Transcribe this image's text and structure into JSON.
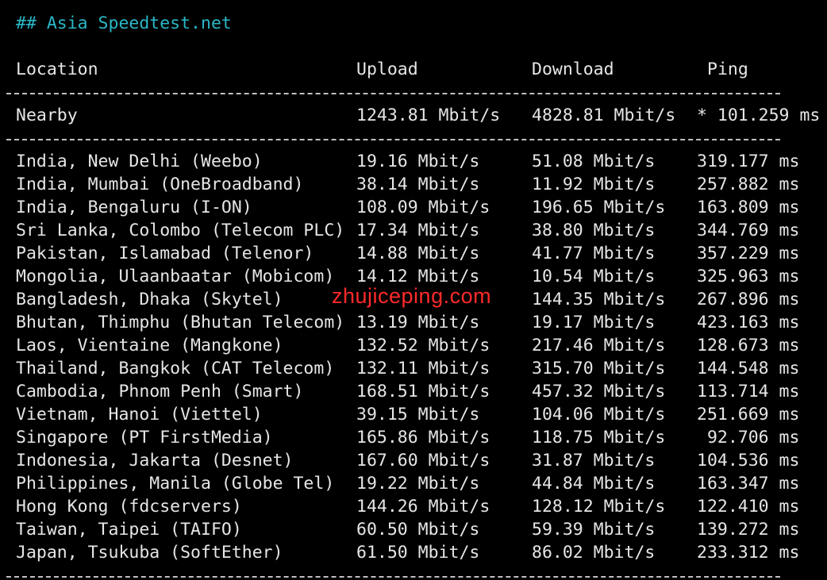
{
  "heading": "## Asia Speedtest.net",
  "columns": {
    "location": "Location",
    "upload": "Upload",
    "download": "Download",
    "ping": "Ping"
  },
  "nearby": {
    "location": "Nearby",
    "upload": "1243.81 Mbit/s",
    "download": "4828.81 Mbit/s",
    "ping": "* 101.259 ms"
  },
  "rows": [
    {
      "location": "India, New Delhi (Weebo)",
      "upload": "19.16 Mbit/s",
      "download": "51.08 Mbit/s",
      "ping": "319.177 ms"
    },
    {
      "location": "India, Mumbai (OneBroadband)",
      "upload": "38.14 Mbit/s",
      "download": "11.92 Mbit/s",
      "ping": "257.882 ms"
    },
    {
      "location": "India, Bengaluru (I-ON)",
      "upload": "108.09 Mbit/s",
      "download": "196.65 Mbit/s",
      "ping": "163.809 ms"
    },
    {
      "location": "Sri Lanka, Colombo (Telecom PLC)",
      "upload": "17.34 Mbit/s",
      "download": "38.80 Mbit/s",
      "ping": "344.769 ms"
    },
    {
      "location": "Pakistan, Islamabad (Telenor)",
      "upload": "14.88 Mbit/s",
      "download": "41.77 Mbit/s",
      "ping": "357.229 ms"
    },
    {
      "location": "Mongolia, Ulaanbaatar (Mobicom)",
      "upload": "14.12 Mbit/s",
      "download": "10.54 Mbit/s",
      "ping": "325.963 ms"
    },
    {
      "location": "Bangladesh, Dhaka (Skytel)",
      "upload": "",
      "download": "144.35 Mbit/s",
      "ping": "267.896 ms"
    },
    {
      "location": "Bhutan, Thimphu (Bhutan Telecom)",
      "upload": "13.19 Mbit/s",
      "download": "19.17 Mbit/s",
      "ping": "423.163 ms"
    },
    {
      "location": "Laos, Vientaine (Mangkone)",
      "upload": "132.52 Mbit/s",
      "download": "217.46 Mbit/s",
      "ping": "128.673 ms"
    },
    {
      "location": "Thailand, Bangkok (CAT Telecom)",
      "upload": "132.11 Mbit/s",
      "download": "315.70 Mbit/s",
      "ping": "144.548 ms"
    },
    {
      "location": "Cambodia, Phnom Penh (Smart)",
      "upload": "168.51 Mbit/s",
      "download": "457.32 Mbit/s",
      "ping": "113.714 ms"
    },
    {
      "location": "Vietnam, Hanoi (Viettel)",
      "upload": "39.15 Mbit/s",
      "download": "104.06 Mbit/s",
      "ping": "251.669 ms"
    },
    {
      "location": "Singapore (PT FirstMedia)",
      "upload": "165.86 Mbit/s",
      "download": "118.75 Mbit/s",
      "ping": " 92.706 ms"
    },
    {
      "location": "Indonesia, Jakarta (Desnet)",
      "upload": "167.60 Mbit/s",
      "download": "31.87 Mbit/s",
      "ping": "104.536 ms"
    },
    {
      "location": "Philippines, Manila (Globe Tel)",
      "upload": "19.22 Mbit/s",
      "download": "44.84 Mbit/s",
      "ping": "163.347 ms"
    },
    {
      "location": "Hong Kong (fdcservers)",
      "upload": "144.26 Mbit/s",
      "download": "128.12 Mbit/s",
      "ping": "122.410 ms"
    },
    {
      "location": "Taiwan, Taipei (TAIFO)",
      "upload": "60.50 Mbit/s",
      "download": "59.39 Mbit/s",
      "ping": "139.272 ms"
    },
    {
      "location": "Japan, Tsukuba (SoftEther)",
      "upload": "61.50 Mbit/s",
      "download": "86.02 Mbit/s",
      "ping": "233.312 ms"
    }
  ],
  "watermark": "zhujiceping.com",
  "colors": {
    "background": "#000000",
    "text": "#e6e6e6",
    "heading": "#2ab7c6",
    "watermark": "#ff2a2a"
  }
}
